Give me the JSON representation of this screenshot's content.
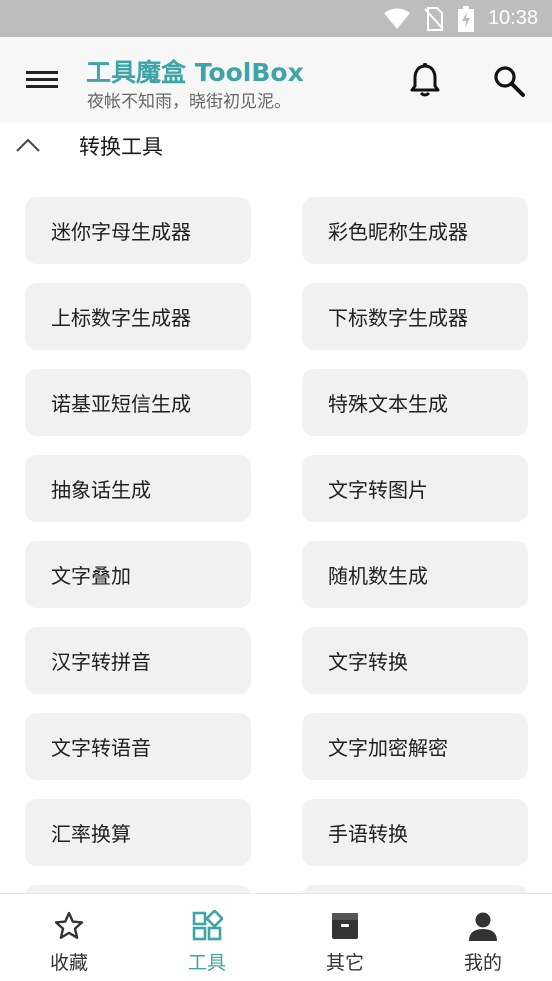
{
  "status_bar": {
    "time": "10:38"
  },
  "app_bar": {
    "title": "工具魔盒 ToolBox",
    "subtitle": "夜帐不知雨，晓街初见泥。",
    "accent": "#3fa4a8"
  },
  "section": {
    "title": "转换工具"
  },
  "tools": [
    "迷你字母生成器",
    "彩色昵称生成器",
    "上标数字生成器",
    "下标数字生成器",
    "诺基亚短信生成",
    "特殊文本生成",
    "抽象话生成",
    "文字转图片",
    "文字叠加",
    "随机数生成",
    "汉字转拼音",
    "文字转换",
    "文字转语音",
    "文字加密解密",
    "汇率换算",
    "手语转换"
  ],
  "bottom_nav": {
    "items": [
      {
        "label": "收藏",
        "icon": "star-icon"
      },
      {
        "label": "工具",
        "icon": "grid-apps-icon"
      },
      {
        "label": "其它",
        "icon": "archive-icon"
      },
      {
        "label": "我的",
        "icon": "person-icon"
      }
    ],
    "active_index": 1
  }
}
